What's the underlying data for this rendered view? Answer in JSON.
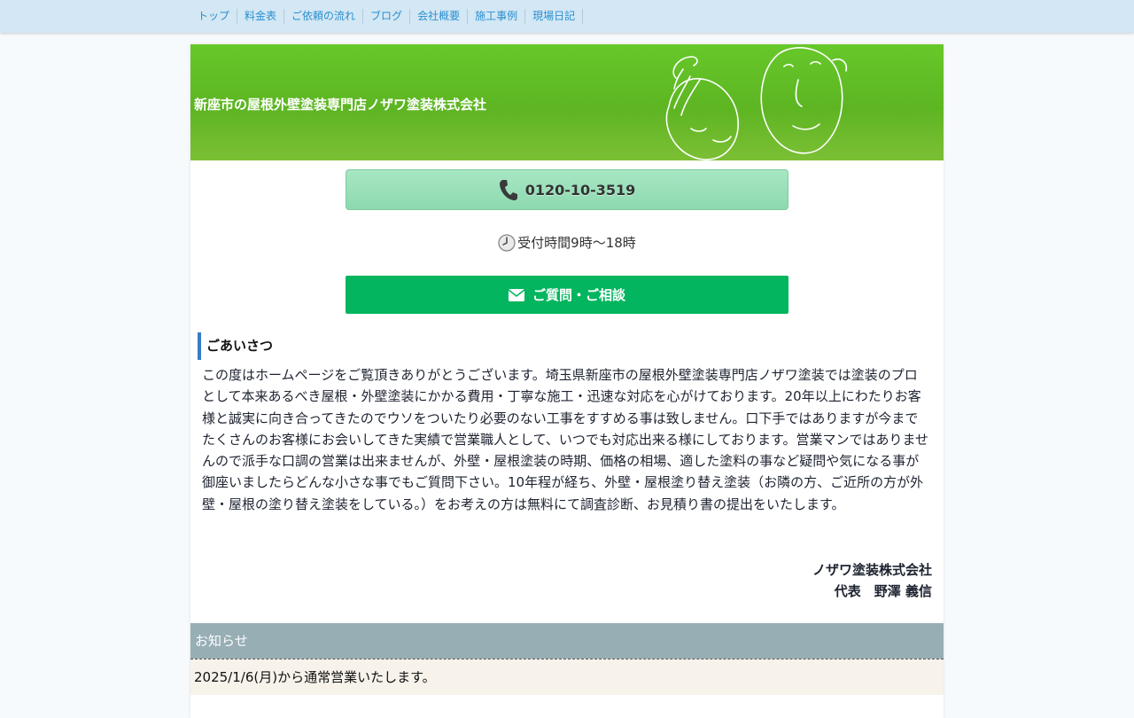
{
  "nav": {
    "items": [
      "トップ",
      "料金表",
      "ご依頼の流れ",
      "ブログ",
      "会社概要",
      "施工事例",
      "現場日記"
    ]
  },
  "header": {
    "title": "新座市の屋根外壁塗装専門店ノザワ塗装株式会社"
  },
  "contact": {
    "phone": "0120-10-3519",
    "hours": "受付時間9時〜18時",
    "inquiry_label": "ご質問・ご相談"
  },
  "greeting": {
    "heading": "ごあいさつ",
    "body": "この度はホームページをご覧頂きありがとうございます。埼玉県新座市の屋根外壁塗装専門店ノザワ塗装では塗装のプロとして本来あるべき屋根・外壁塗装にかかる費用・丁寧な施工・迅速な対応を心がけております。20年以上にわたりお客様と誠実に向き合ってきたのでウソをついたり必要のない工事をすすめる事は致しません。口下手ではありますが今までたくさんのお客様にお会いしてきた実績で営業職人として、いつでも対応出来る様にしております。営業マンではありませんので派手な口調の営業は出来ませんが、外壁・屋根塗装の時期、価格の相場、適した塗料の事など疑問や気になる事が御座いましたらどんな小さな事でもご質問下さい。10年程が経ち、外壁・屋根塗り替え塗装（お隣の方、ご近所の方が外壁・屋根の塗り替え塗装をしている。）をお考えの方は無料にて調査診断、お見積り書の提出をいたします。",
    "company": "ノザワ塗装株式会社",
    "representative": "代表　野澤 義信"
  },
  "news": {
    "heading": "お知らせ",
    "items": [
      "2025/1/6(月)から通常営業いたします。"
    ]
  },
  "colors": {
    "header_green": "#5db522",
    "tel_button": "#a7e7c3",
    "mail_button": "#02b55e",
    "news_header": "#97aeb5",
    "nav_bg": "#d3e7f4",
    "nav_link": "#2a8fcf"
  }
}
